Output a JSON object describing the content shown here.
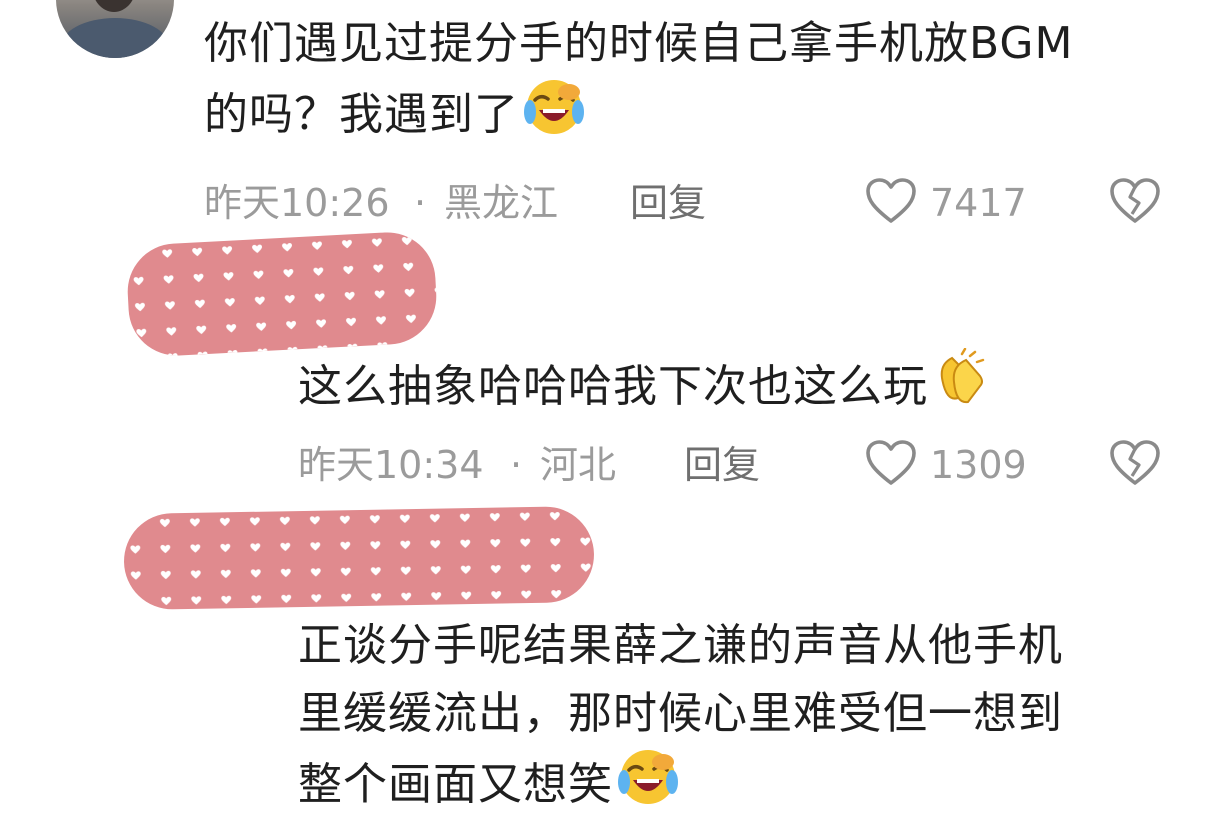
{
  "comments": [
    {
      "text_lines": [
        "你们遇见过提分手的时候自己拿手机放BGM",
        "的吗？我遇到了"
      ],
      "time": "昨天10:26",
      "separator": "·",
      "location": "黑龙江",
      "reply_label": "回复",
      "like_count": "7417",
      "trailing_emoji": "crying-laughing-emoji-icon"
    },
    {
      "text_lines": [
        "这么抽象哈哈哈我下次也这么玩"
      ],
      "time": "昨天10:34",
      "separator": "·",
      "location": "河北",
      "reply_label": "回复",
      "like_count": "1309",
      "trailing_emoji": "clapping-hands-emoji-icon"
    },
    {
      "text_lines": [
        "正谈分手呢结果薛之谦的声音从他手机",
        "里缓缓流出，那时候心里难受但一想到",
        "整个画面又想笑"
      ],
      "trailing_emoji": "crying-laughing-emoji-icon"
    }
  ],
  "colors": {
    "text": "#1f1f1f",
    "meta": "#9b9b9b",
    "icon": "#8a8a8a",
    "redaction": "#e08a8e",
    "emoji_face": "#f7c531"
  },
  "icons": {
    "like": "heart-outline-icon",
    "dislike": "broken-heart-icon"
  }
}
